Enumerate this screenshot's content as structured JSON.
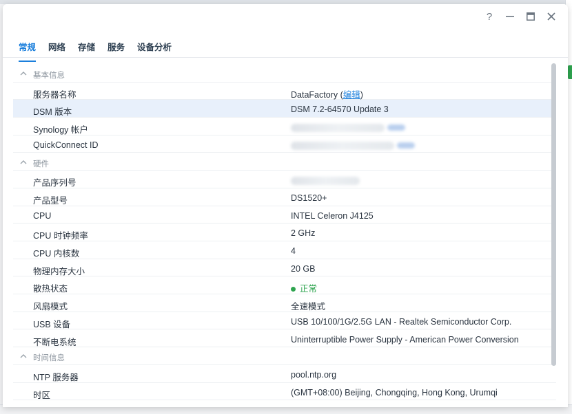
{
  "window": {
    "controls": {
      "help": "?",
      "minimize": "—",
      "maximize": "▭",
      "close": "✕"
    }
  },
  "tabs": [
    "常规",
    "网络",
    "存储",
    "服务",
    "设备分析"
  ],
  "active_tab": 0,
  "sections": {
    "basic": {
      "title": "基本信息",
      "rows": {
        "server_name": {
          "label": "服务器名称",
          "value": "DataFactory",
          "edit": "编辑"
        },
        "dsm_version": {
          "label": "DSM 版本",
          "value": "DSM 7.2-64570 Update 3"
        },
        "synology_account": {
          "label": "Synology 帐户"
        },
        "quickconnect": {
          "label": "QuickConnect ID"
        }
      }
    },
    "hardware": {
      "title": "硬件",
      "rows": {
        "serial": {
          "label": "产品序列号"
        },
        "model": {
          "label": "产品型号",
          "value": "DS1520+"
        },
        "cpu": {
          "label": "CPU",
          "value": "INTEL Celeron J4125"
        },
        "cpu_clock": {
          "label": "CPU 时钟频率",
          "value": "2 GHz"
        },
        "cpu_cores": {
          "label": "CPU 内核数",
          "value": "4"
        },
        "memory": {
          "label": "物理内存大小",
          "value": "20 GB"
        },
        "thermal": {
          "label": "散热状态",
          "value": "正常"
        },
        "fan": {
          "label": "风扇模式",
          "value": "全速模式"
        },
        "usb": {
          "label": "USB 设备",
          "value": "USB 10/100/1G/2.5G LAN - Realtek Semiconductor Corp."
        },
        "ups": {
          "label": "不断电系统",
          "value": "Uninterruptible Power Supply - American Power Conversion"
        }
      }
    },
    "time": {
      "title": "时间信息",
      "rows": {
        "ntp": {
          "label": "NTP 服务器",
          "value": "pool.ntp.org"
        },
        "timezone": {
          "label": "时区",
          "value": "(GMT+08:00) Beijing, Chongqing, Hong Kong, Urumqi"
        }
      }
    }
  },
  "colors": {
    "accent": "#1b7fdc",
    "status_ok": "#2ea44f",
    "highlight_row": "#e8f0fb"
  }
}
